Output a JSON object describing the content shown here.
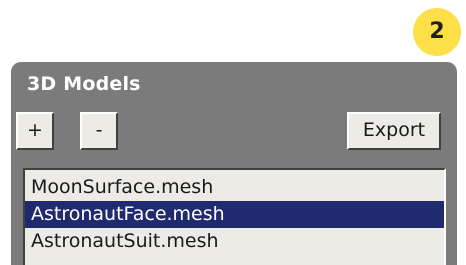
{
  "step_badge": {
    "label": "2",
    "color": "#fde047"
  },
  "panel": {
    "title": "3D Models",
    "background": "#7b7b7b",
    "buttons": {
      "add_label": "+",
      "remove_label": "-",
      "export_label": "Export"
    },
    "models": [
      {
        "label": "MoonSurface.mesh",
        "selected": false
      },
      {
        "label": "AstronautFace.mesh",
        "selected": true
      },
      {
        "label": "AstronautSuit.mesh",
        "selected": false
      }
    ],
    "selection_color": "#1f2b6e"
  }
}
